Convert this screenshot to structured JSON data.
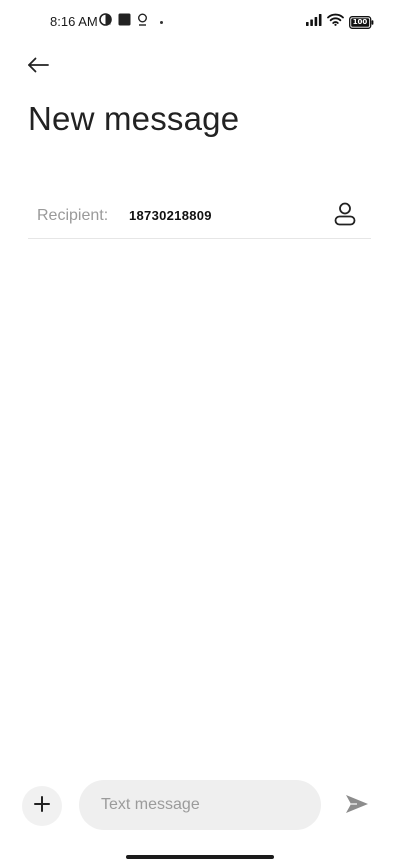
{
  "status_bar": {
    "time": "8:16 AM",
    "icons_left": [
      "data-saver-icon",
      "stop-square-icon",
      "location-pin-icon",
      "more-dot-icon"
    ],
    "icons_right": [
      "signal-icon",
      "wifi-icon",
      "battery-icon"
    ],
    "battery_label": "100"
  },
  "header": {
    "back_icon": "arrow-left-icon",
    "title": "New message"
  },
  "recipient": {
    "label": "Recipient:",
    "value": "18730218809",
    "contact_icon": "person-icon"
  },
  "composer": {
    "attach_icon": "plus-icon",
    "placeholder": "Text message",
    "value": "",
    "send_icon": "send-icon"
  },
  "colors": {
    "background": "#ffffff",
    "input_bg": "#efefef",
    "placeholder": "#9b9b9b",
    "label": "#9a9a9a",
    "divider": "#e6e6e6",
    "send_icon": "#8c8c8c"
  }
}
